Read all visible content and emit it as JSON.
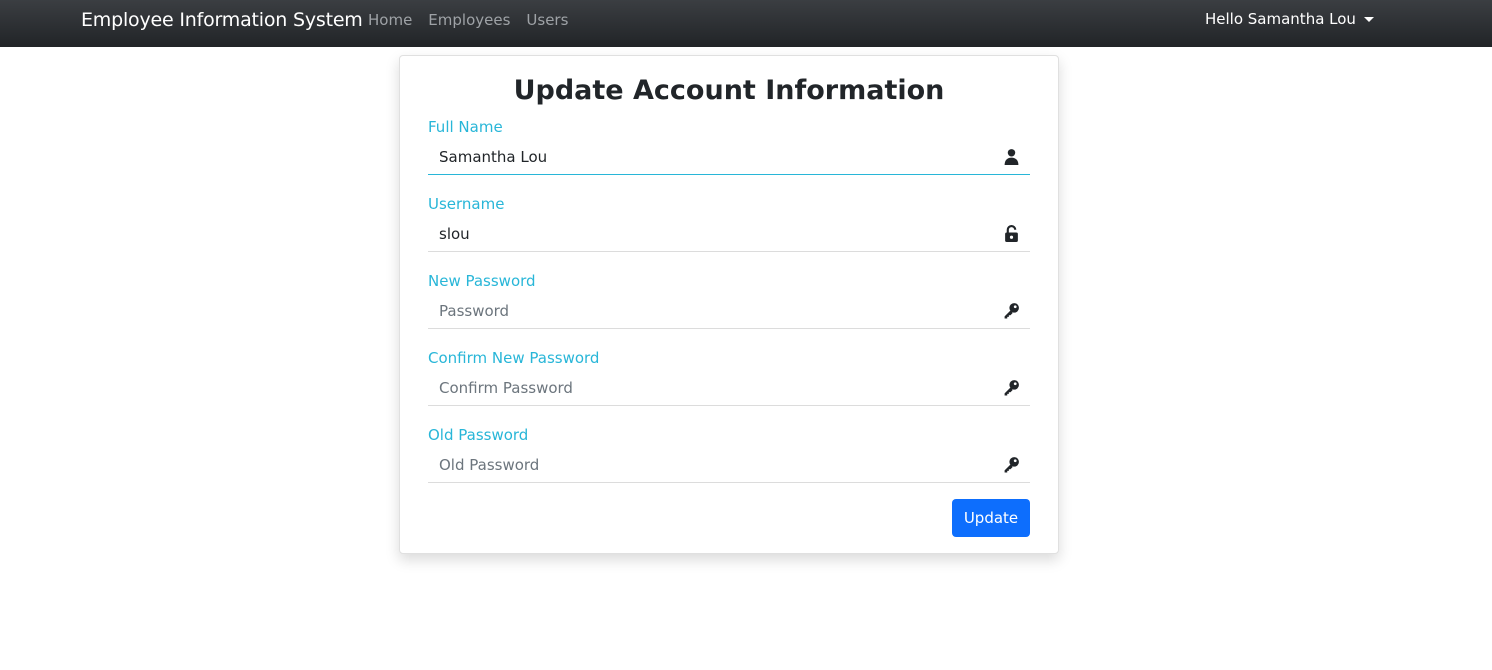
{
  "navbar": {
    "brand": "Employee Information System",
    "links": [
      {
        "label": "Home"
      },
      {
        "label": "Employees"
      },
      {
        "label": "Users"
      }
    ],
    "user_menu": "Hello Samantha Lou"
  },
  "form": {
    "title": "Update Account Information",
    "fields": [
      {
        "label": "Full Name",
        "value": "Samantha Lou",
        "placeholder": "",
        "icon": "user-icon"
      },
      {
        "label": "Username",
        "value": "slou",
        "placeholder": "",
        "icon": "unlock-icon"
      },
      {
        "label": "New Password",
        "value": "",
        "placeholder": "Password",
        "icon": "key-icon"
      },
      {
        "label": "Confirm New Password",
        "value": "",
        "placeholder": "Confirm Password",
        "icon": "key-icon"
      },
      {
        "label": "Old Password",
        "value": "",
        "placeholder": "Old Password",
        "icon": "key-icon"
      }
    ],
    "submit_label": "Update"
  },
  "colors": {
    "navbar": "#212427",
    "label": "#28b6d8",
    "button": "#0d6efd"
  }
}
